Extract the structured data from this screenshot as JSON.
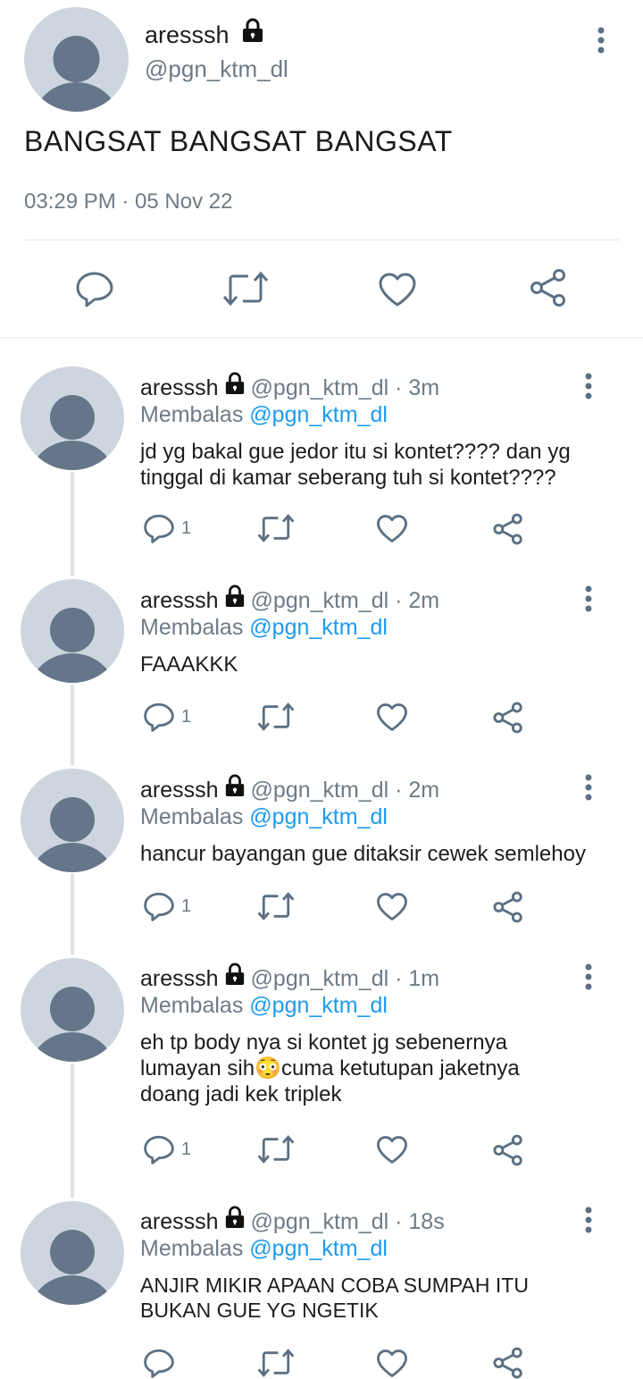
{
  "main_tweet": {
    "display_name": "aresssh",
    "handle": "@pgn_ktm_dl",
    "text": "BANGSAT BANGSAT BANGSAT",
    "timestamp": "03:29 PM · 05 Nov 22",
    "icons": [
      "reply-icon",
      "retweet-icon",
      "like-icon",
      "share-icon"
    ]
  },
  "replies": [
    {
      "display_name": "aresssh",
      "meta": "@pgn_ktm_dl · 3m",
      "reply_label": "Membalas",
      "reply_to": "@pgn_ktm_dl",
      "text": "jd yg bakal gue jedor itu si kontet???? dan yg tinggal di kamar seberang tuh si kontet????",
      "reply_count": "1"
    },
    {
      "display_name": "aresssh",
      "meta": "@pgn_ktm_dl · 2m",
      "reply_label": "Membalas",
      "reply_to": "@pgn_ktm_dl",
      "text": "FAAAKKK",
      "reply_count": "1"
    },
    {
      "display_name": "aresssh",
      "meta": "@pgn_ktm_dl · 2m",
      "reply_label": "Membalas",
      "reply_to": "@pgn_ktm_dl",
      "text": "hancur bayangan gue ditaksir cewek semlehoy",
      "reply_count": "1"
    },
    {
      "display_name": "aresssh",
      "meta": "@pgn_ktm_dl · 1m",
      "reply_label": "Membalas",
      "reply_to": "@pgn_ktm_dl",
      "text": "eh tp body nya si kontet jg sebenernya lumayan sih😳cuma ketutupan jaketnya doang jadi kek triplek",
      "reply_count": "1"
    },
    {
      "display_name": "aresssh",
      "meta": "@pgn_ktm_dl · 18s",
      "reply_label": "Membalas",
      "reply_to": "@pgn_ktm_dl",
      "text": "ANJIR MIKIR APAAN COBA SUMPAH ITU BUKAN GUE YG NGETIK",
      "reply_count": ""
    }
  ],
  "colors": {
    "icon": "#5b7083",
    "muted": "#6e7b87",
    "mention": "#1d9bf0",
    "avatar_bg": "#cdd6de",
    "avatar_fg": "#66768a"
  }
}
